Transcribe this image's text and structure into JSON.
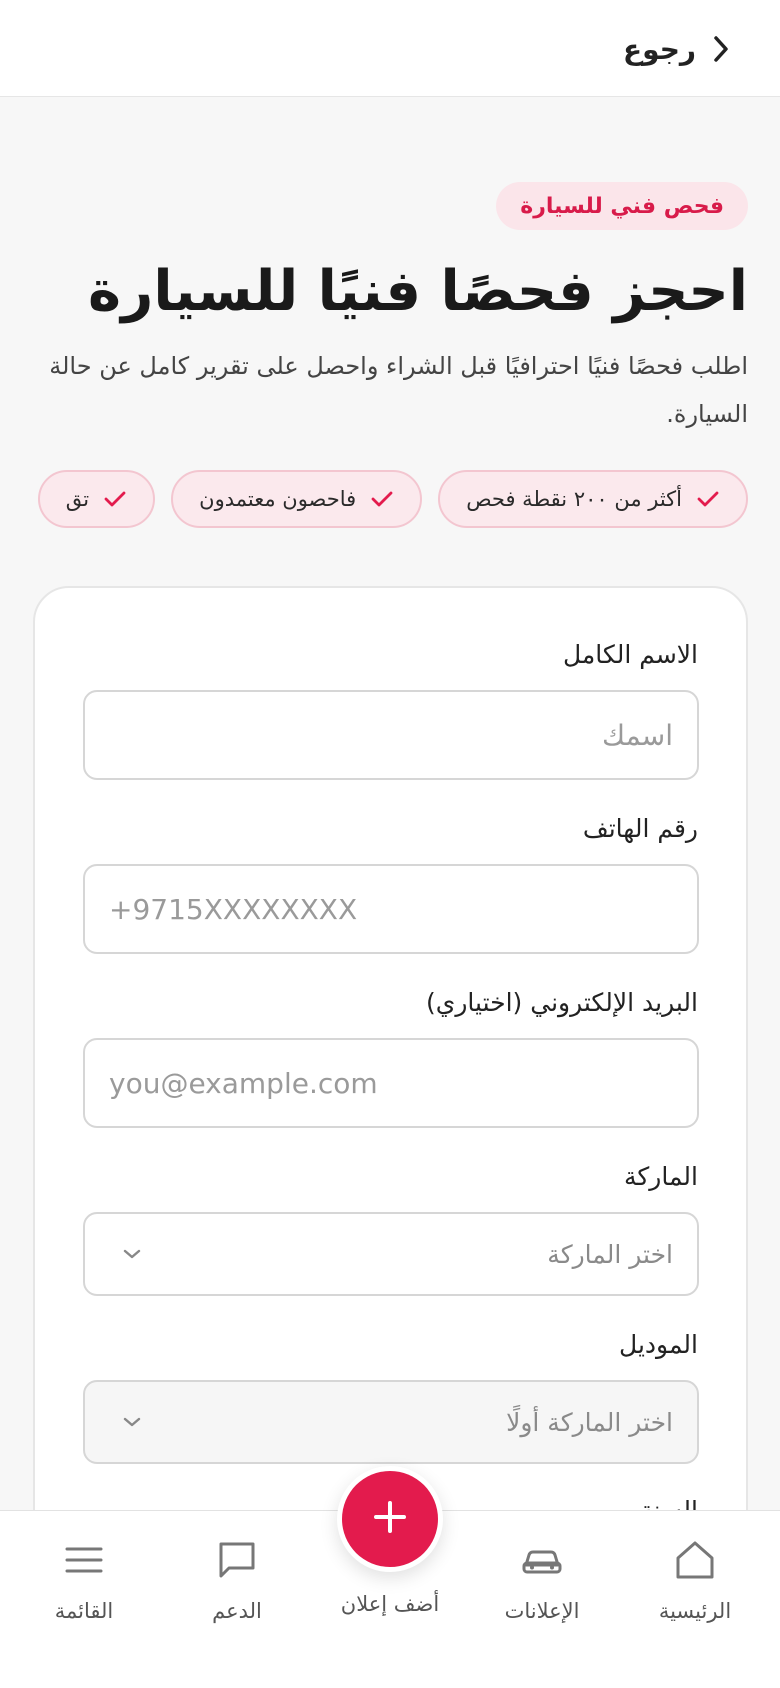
{
  "header": {
    "back_label": "رجوع",
    "back_icon": "chevron-right-icon"
  },
  "hero": {
    "badge": "فحص فني للسيارة",
    "title": "احجز فحصًا فنيًا للسيارة",
    "description": "اطلب فحصًا فنيًا احترافيًا قبل الشراء واحصل على تقرير كامل عن حالة السيارة.",
    "chips": [
      {
        "label": "أكثر من ٢٠٠ نقطة فحص",
        "icon": "check-icon"
      },
      {
        "label": "فاحصون معتمدون",
        "icon": "check-icon"
      },
      {
        "label": "تق",
        "icon": "check-icon"
      }
    ]
  },
  "form": {
    "full_name": {
      "label": "الاسم الكامل",
      "placeholder": "اسمك"
    },
    "phone": {
      "label": "رقم الهاتف",
      "placeholder": "+9715XXXXXXXX"
    },
    "email": {
      "label": "البريد الإلكتروني (اختياري)",
      "placeholder": "you@example.com"
    },
    "brand": {
      "label": "الماركة",
      "selected": "اختر الماركة"
    },
    "model": {
      "label": "الموديل",
      "selected": "اختر الماركة أولًا"
    },
    "next_label": "السنة"
  },
  "bottom_nav": {
    "items": [
      {
        "label": "الرئيسية",
        "icon": "home-icon"
      },
      {
        "label": "الإعلانات",
        "icon": "car-icon"
      },
      {
        "label": "الدعم",
        "icon": "chat-icon"
      },
      {
        "label": "القائمة",
        "icon": "menu-icon"
      }
    ],
    "fab_label": "أضف إعلان",
    "fab_icon": "plus-icon"
  },
  "colors": {
    "accent": "#e31b4d",
    "badge_bg": "#fbe5ea",
    "chip_border": "#f3c6d0",
    "page_bg": "#f7f7f7"
  }
}
